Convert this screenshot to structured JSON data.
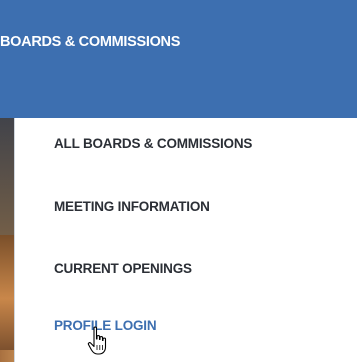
{
  "menu": {
    "title": "BOARDS & COMMISSIONS",
    "items": [
      {
        "label": "ALL BOARDS & COMMISSIONS"
      },
      {
        "label": "MEETING INFORMATION"
      },
      {
        "label": "CURRENT OPENINGS"
      },
      {
        "label": "PROFILE LOGIN"
      }
    ]
  },
  "colors": {
    "header_bg": "#3d6fb0",
    "item_text": "#2b2f36",
    "hover_text": "#3d6fb0"
  },
  "cursor": "hand-pointer-icon"
}
